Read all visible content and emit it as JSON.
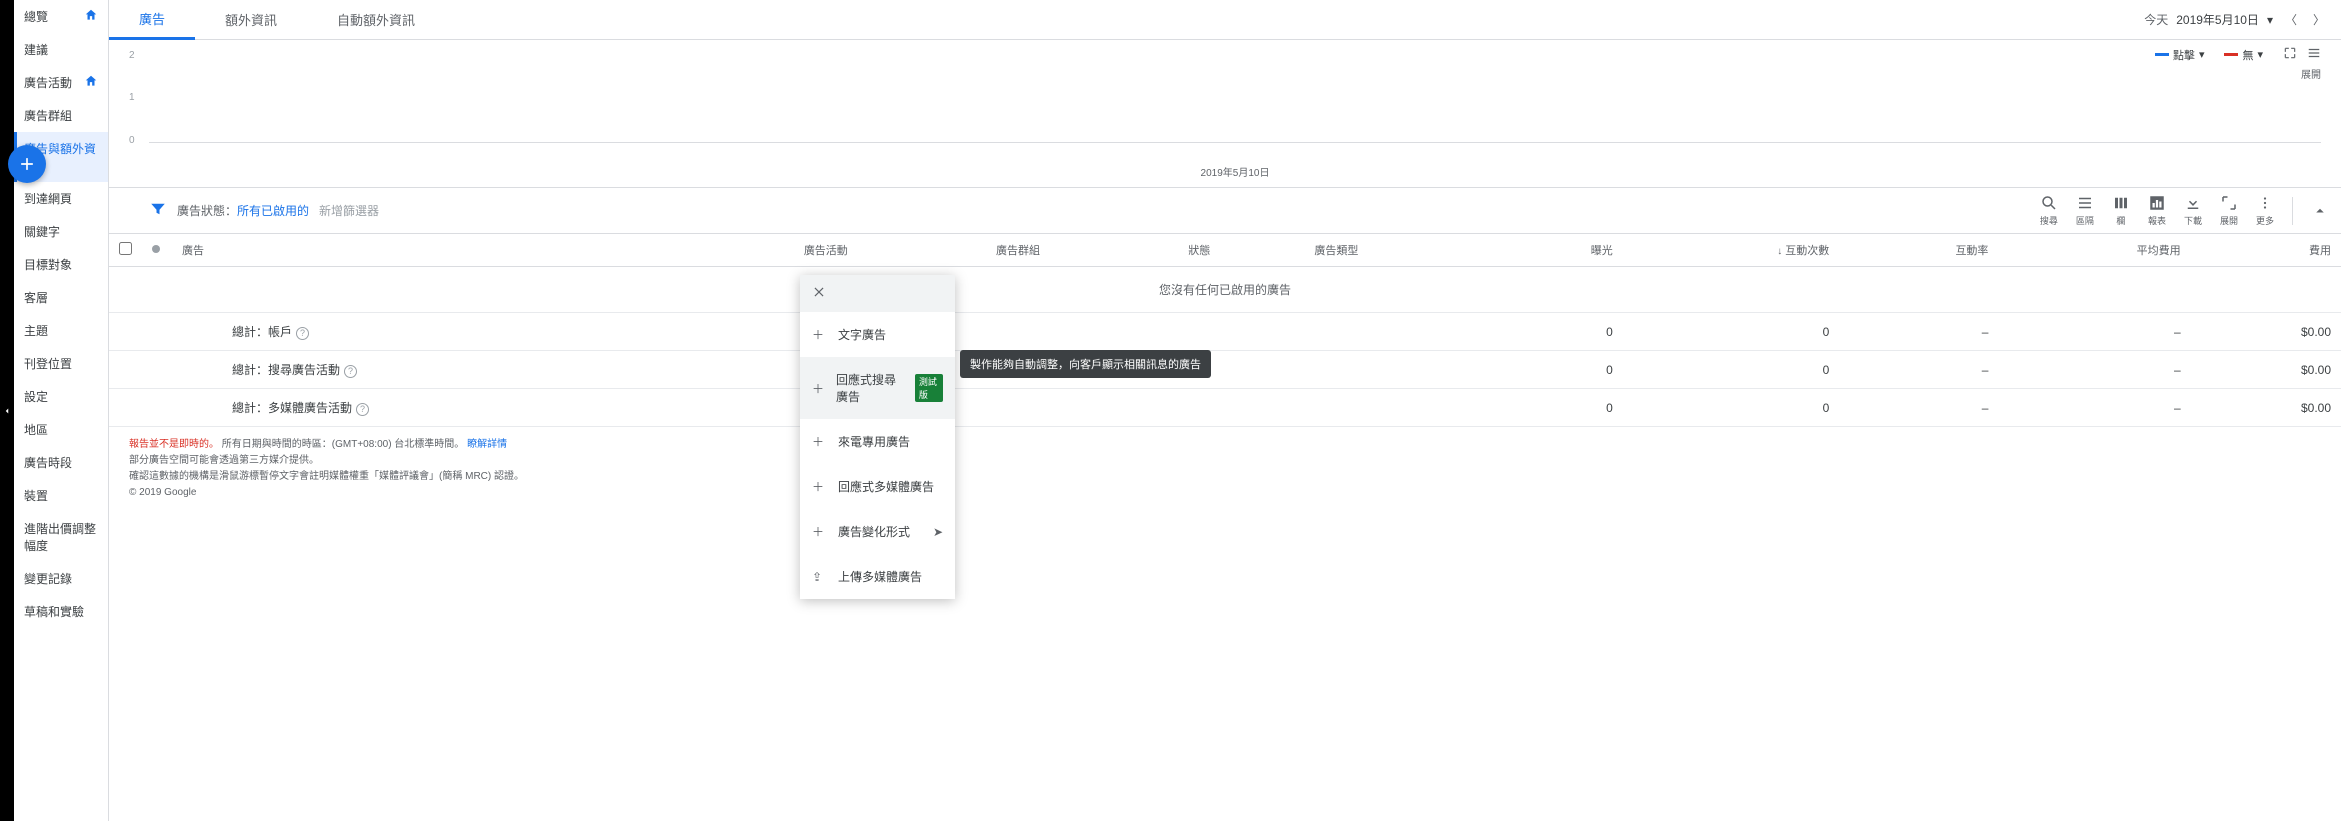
{
  "sidebar": {
    "items": [
      {
        "label": "總覽",
        "home": true
      },
      {
        "label": "建議"
      },
      {
        "label": "廣告活動",
        "home": true
      },
      {
        "label": "廣告群組"
      },
      {
        "label": "廣告與額外資訊",
        "active": true
      },
      {
        "label": "到達網頁"
      },
      {
        "label": "關鍵字"
      },
      {
        "label": "目標對象"
      },
      {
        "label": "客層"
      },
      {
        "label": "主題"
      },
      {
        "label": "刊登位置"
      },
      {
        "label": "設定"
      },
      {
        "label": "地區"
      },
      {
        "label": "廣告時段"
      },
      {
        "label": "裝置"
      },
      {
        "label": "進階出價調整幅度"
      },
      {
        "label": "變更記錄"
      },
      {
        "label": "草稿和實驗"
      }
    ]
  },
  "tabs": [
    "廣告",
    "額外資訊",
    "自動額外資訊"
  ],
  "date": {
    "today": "今天",
    "value": "2019年5月10日"
  },
  "legend": {
    "a": "點擊",
    "b": "無",
    "expand": "展開"
  },
  "chart_data": {
    "type": "line",
    "y_ticks": [
      "2",
      "1",
      "0"
    ],
    "x_label": "2019年5月10日",
    "series": [
      {
        "name": "點擊",
        "values": [
          0
        ]
      },
      {
        "name": "無",
        "values": [
          0
        ]
      }
    ]
  },
  "filter": {
    "key": "廣告狀態：",
    "value": "所有已啟用的",
    "add": "新增篩選器"
  },
  "toolbar": {
    "search": "搜尋",
    "segment": "區隔",
    "columns": "欄",
    "reports": "報表",
    "download": "下載",
    "expand": "展開",
    "more": "更多"
  },
  "table": {
    "headers": {
      "ad": "廣告",
      "campaign": "廣告活動",
      "adgroup": "廣告群組",
      "status": "狀態",
      "adtype": "廣告類型",
      "impr": "曝光",
      "interactions": "互動次數",
      "rate": "互動率",
      "avgcost": "平均費用",
      "cost": "費用"
    },
    "empty": "您沒有任何已啟用的廣告",
    "rows": [
      {
        "label": "總計：帳戶",
        "impr": "0",
        "inter": "0",
        "rate": "–",
        "avg": "–",
        "cost": "$0.00"
      },
      {
        "label": "總計：搜尋廣告活動",
        "impr": "0",
        "inter": "0",
        "rate": "–",
        "avg": "–",
        "cost": "$0.00"
      },
      {
        "label": "總計：多媒體廣告活動",
        "impr": "0",
        "inter": "0",
        "rate": "–",
        "avg": "–",
        "cost": "$0.00"
      }
    ]
  },
  "popup": {
    "items": [
      {
        "label": "文字廣告",
        "icon": "plus"
      },
      {
        "label": "回應式搜尋廣告",
        "icon": "plus",
        "badge": "測試版",
        "hover": true
      },
      {
        "label": "來電專用廣告",
        "icon": "plus"
      },
      {
        "label": "回應式多媒體廣告",
        "icon": "plus"
      },
      {
        "label": "廣告變化形式",
        "icon": "plus",
        "arrow": true
      },
      {
        "label": "上傳多媒體廣告",
        "icon": "upload"
      }
    ]
  },
  "tooltip": "製作能夠自動調整，向客戶顯示相關訊息的廣告",
  "footer": {
    "l1a": "報告並不是即時的。",
    "l1b": "所有日期與時間的時區：(GMT+08:00) 台北標準時間。",
    "l1c": "瞭解詳情",
    "l2": "部分廣告空間可能會透過第三方媒介提供。",
    "l3": "確認這數據的機構是滑鼠游標暫停文字會註明媒體權重「媒體評議會」(簡稱 MRC) 認證。",
    "copy": "© 2019 Google"
  }
}
